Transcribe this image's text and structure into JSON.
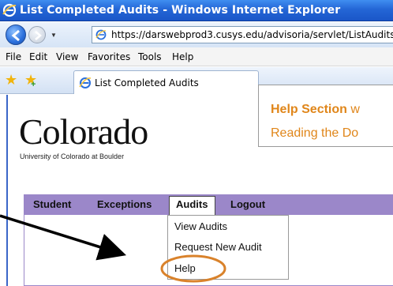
{
  "window": {
    "title": "List Completed Audits - Windows Internet Explorer"
  },
  "address": {
    "url": "https://darswebprod3.cusys.edu/advisoria/servlet/ListAudits"
  },
  "menu": {
    "items": [
      "File",
      "Edit",
      "View",
      "Favorites",
      "Tools",
      "Help"
    ]
  },
  "tab": {
    "label": "List Completed Audits"
  },
  "branding": {
    "logo_text": "Colorado",
    "subtitle": "University of Colorado at Boulder"
  },
  "site_nav": {
    "items": [
      "Student",
      "Exceptions",
      "Audits",
      "Logout"
    ],
    "active": "Audits"
  },
  "audits_menu": {
    "items": [
      "View Audits",
      "Request New Audit",
      "Help"
    ],
    "highlighted": "Help"
  },
  "callout": {
    "line1_bold": "Help Section",
    "line1_rest": " w",
    "line2": "Reading the Do"
  },
  "colors": {
    "titlebar": "#2466d6",
    "nav_purple": "#9b87c9",
    "callout_orange": "#e0861a",
    "highlight_ring": "#d9822b"
  },
  "icons": [
    "ie-logo-icon",
    "back-arrow-icon",
    "forward-arrow-icon",
    "page-icon",
    "favorites-star-icon",
    "add-favorite-icon"
  ]
}
